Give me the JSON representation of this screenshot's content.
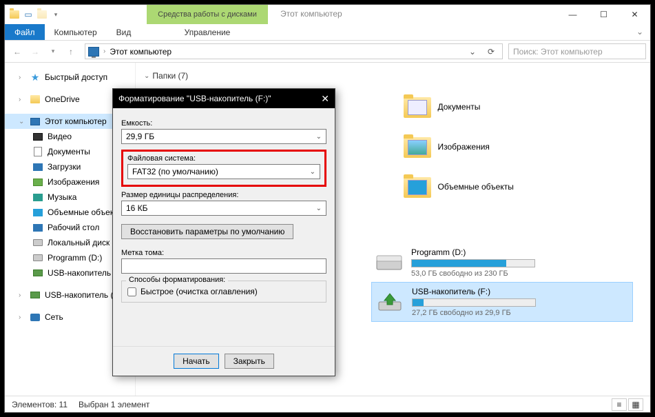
{
  "window": {
    "contextual_header": "Средства работы с дисками",
    "contextual_tab": "Управление",
    "title": "Этот компьютер",
    "ribbon": {
      "file": "Файл",
      "computer": "Компьютер",
      "view": "Вид"
    }
  },
  "nav": {
    "address": "Этот компьютер",
    "search_placeholder": "Поиск: Этот компьютер"
  },
  "tree": {
    "quick": "Быстрый доступ",
    "onedrive": "OneDrive",
    "thispc": "Этот компьютер",
    "children": {
      "video": "Видео",
      "documents": "Документы",
      "downloads": "Загрузки",
      "images": "Изображения",
      "music": "Музыка",
      "objects3d": "Объемные объекть",
      "desktop": "Рабочий стол",
      "localc": "Локальный диск (C",
      "programm": "Programm (D:)",
      "usb": "USB-накопитель (",
      "usb2": "USB-накопитель (F:)"
    },
    "network": "Сеть"
  },
  "main": {
    "section": "Папки (7)",
    "folders": {
      "documents": "Документы",
      "images": "Изображения",
      "objects3d": "Объемные объекты"
    },
    "drives": {
      "programm": {
        "name": "Programm (D:)",
        "free": "53,0 ГБ свободно из 230 ГБ",
        "pct": 77
      },
      "usb": {
        "name": "USB-накопитель (F:)",
        "free": "27,2 ГБ свободно из 29,9 ГБ",
        "pct": 9
      }
    }
  },
  "dialog": {
    "title": "Форматирование \"USB-накопитель (F:)\"",
    "capacity_label": "Емкость:",
    "capacity_value": "29,9 ГБ",
    "fs_label": "Файловая система:",
    "fs_value": "FAT32 (по умолчанию)",
    "alloc_label": "Размер единицы распределения:",
    "alloc_value": "16 КБ",
    "restore_btn": "Восстановить параметры по умолчанию",
    "volume_label": "Метка тома:",
    "volume_value": "",
    "methods_label": "Способы форматирования:",
    "quick_format": "Быстрое (очистка оглавления)",
    "start_btn": "Начать",
    "close_btn": "Закрыть"
  },
  "status": {
    "items": "Элементов: 11",
    "selected": "Выбран 1 элемент"
  }
}
